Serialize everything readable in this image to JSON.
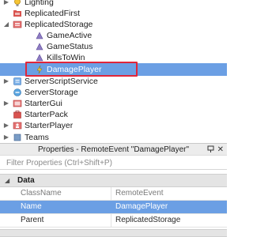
{
  "explorer": {
    "items": [
      {
        "label": "Lighting",
        "icon": "lighting-icon"
      },
      {
        "label": "ReplicatedFirst",
        "icon": "folder-icon"
      },
      {
        "label": "ReplicatedStorage",
        "icon": "storage-icon",
        "expanded": true
      },
      {
        "label": "GameActive",
        "icon": "bool-value-icon"
      },
      {
        "label": "GameStatus",
        "icon": "string-value-icon"
      },
      {
        "label": "KillsToWin",
        "icon": "int-value-icon"
      },
      {
        "label": "DamagePlayer",
        "icon": "remote-event-icon",
        "selected": true
      },
      {
        "label": "ServerScriptService",
        "icon": "server-script-service-icon"
      },
      {
        "label": "ServerStorage",
        "icon": "server-storage-icon"
      },
      {
        "label": "StarterGui",
        "icon": "starter-gui-icon"
      },
      {
        "label": "StarterPack",
        "icon": "starter-pack-icon"
      },
      {
        "label": "StarterPlayer",
        "icon": "starter-player-icon"
      },
      {
        "label": "Teams",
        "icon": "teams-icon"
      }
    ]
  },
  "properties": {
    "title": "Properties - RemoteEvent \"DamagePlayer\"",
    "filter_placeholder": "Filter Properties (Ctrl+Shift+P)",
    "section": "Data",
    "rows": [
      {
        "key": "ClassName",
        "value": "RemoteEvent"
      },
      {
        "key": "Name",
        "value": "DamagePlayer"
      },
      {
        "key": "Parent",
        "value": "ReplicatedStorage"
      }
    ]
  },
  "colors": {
    "selection": "#6b9fe4",
    "highlight_box": "#e0263a"
  }
}
